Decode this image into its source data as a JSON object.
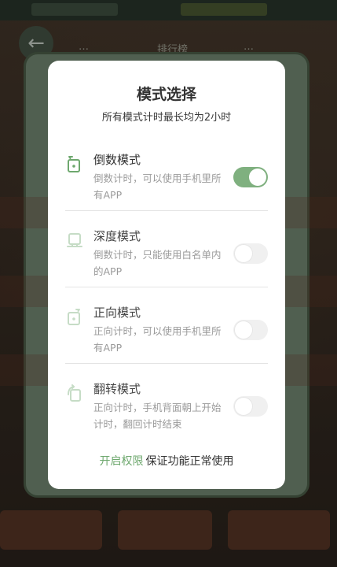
{
  "background": {
    "back_glyph": "←",
    "tabs": [
      "…",
      "排行榜",
      "…"
    ]
  },
  "modal": {
    "title": "模式选择",
    "subtitle": "所有模式计时最长均为2小时",
    "modes": [
      {
        "name": "倒数模式",
        "desc": "倒数计时，可以使用手机里所有APP",
        "enabled": true,
        "icon": "countdown-icon"
      },
      {
        "name": "深度模式",
        "desc": "倒数计时，只能使用白名单内的APP",
        "enabled": false,
        "icon": "deep-focus-icon"
      },
      {
        "name": "正向模式",
        "desc": "正向计时，可以使用手机里所有APP",
        "enabled": false,
        "icon": "count-up-icon"
      },
      {
        "name": "翻转模式",
        "desc": "正向计时，手机背面朝上开始计时，翻回计时结束",
        "enabled": false,
        "icon": "flip-icon"
      }
    ],
    "footer": {
      "link": "开启权限",
      "text": "保证功能正常使用"
    }
  },
  "colors": {
    "accent": "#7fb07f",
    "icon_active": "#6ea86e",
    "icon_inactive": "#c6dcc6"
  }
}
